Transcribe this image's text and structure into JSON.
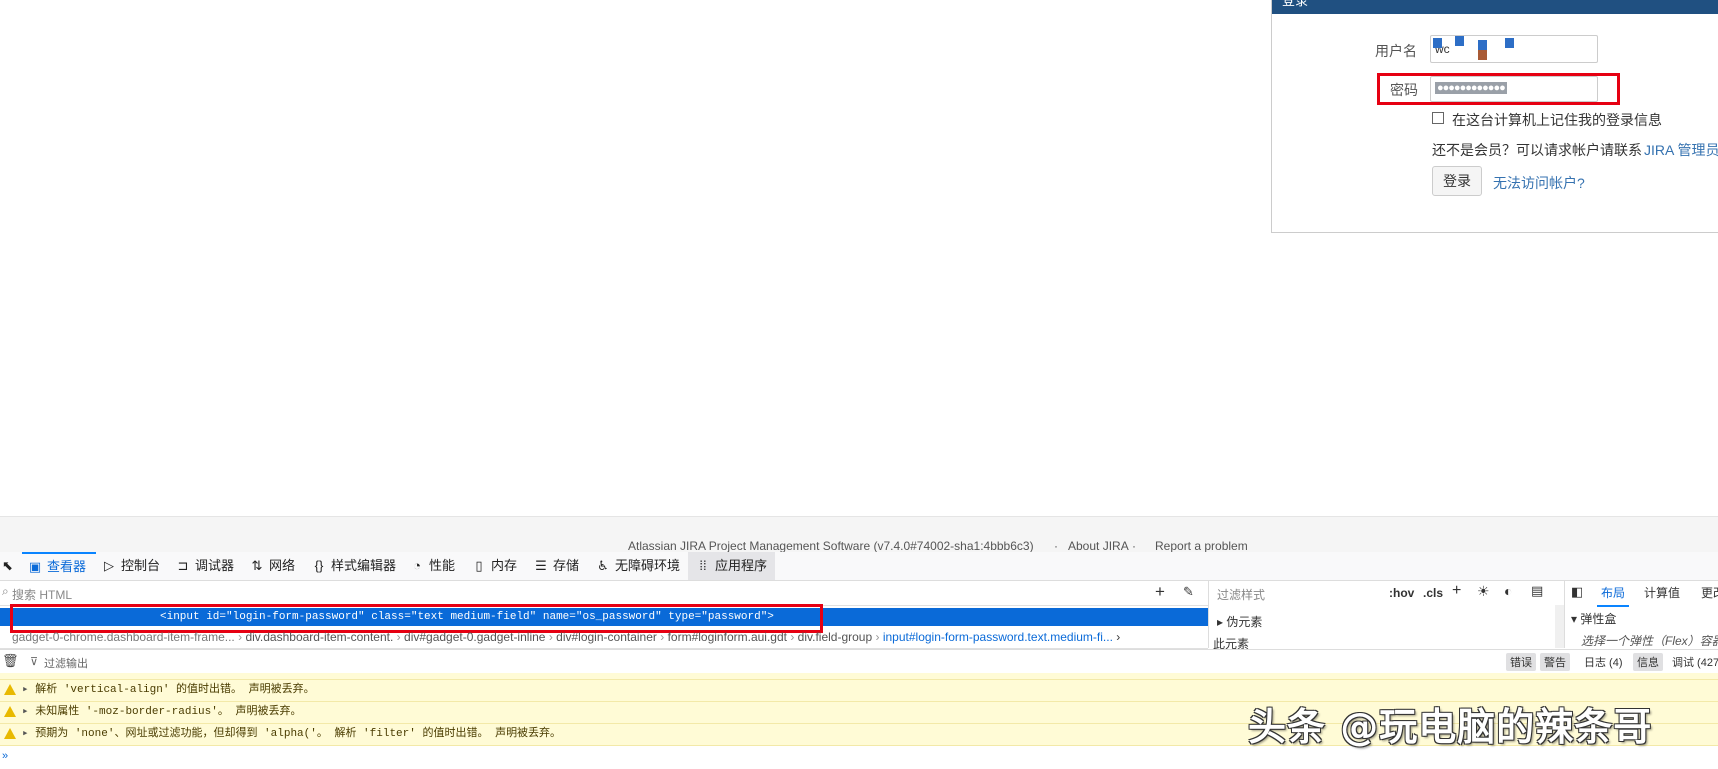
{
  "login": {
    "header": "登录",
    "username_label": "用户名",
    "username_value": "wc",
    "password_label": "密码",
    "password_value": "●●●●●●●●●●●●",
    "remember_label": "在这台计算机上记住我的登录信息",
    "not_member": "还不是会员？可以请求帐户请联系",
    "jira_admin_link": "JIRA 管理员",
    "login_button": "登录",
    "cant_access_link": "无法访问帐户?"
  },
  "footer": {
    "product": "Atlassian JIRA Project Management Software (v7.4.0#74002-sha1:4bbb6c3)",
    "sep": "·",
    "about": "About JIRA",
    "report": "Report a problem"
  },
  "devtools": {
    "tabs": [
      {
        "label": "查看器",
        "icon": "inspector-icon"
      },
      {
        "label": "控制台",
        "icon": "console-icon"
      },
      {
        "label": "调试器",
        "icon": "debugger-icon"
      },
      {
        "label": "网络",
        "icon": "network-icon"
      },
      {
        "label": "样式编辑器",
        "icon": "style-editor-icon"
      },
      {
        "label": "性能",
        "icon": "performance-icon"
      },
      {
        "label": "内存",
        "icon": "memory-icon"
      },
      {
        "label": "存储",
        "icon": "storage-icon"
      },
      {
        "label": "无障碍环境",
        "icon": "accessibility-icon"
      },
      {
        "label": "应用程序",
        "icon": "application-icon"
      }
    ],
    "search_html_placeholder": "搜索 HTML",
    "selected_node": "<input id=\"login-form-password\" class=\"text medium-field\" name=\"os_password\" type=\"password\">",
    "breadcrumb": [
      "gadget-0-chrome.dashboard-item-frame...",
      "div.dashboard-item-content.",
      "div#gadget-0.gadget-inline",
      "div#login-container",
      "form#loginform.aui.gdt",
      "div.field-group",
      "input#login-form-password.text.medium-fi..."
    ],
    "rules": {
      "filter_placeholder": "过滤样式",
      "hov": ":hov",
      "cls": ".cls",
      "pseudo": "伪元素",
      "this_element": "此元素"
    },
    "layout": {
      "tabs": [
        "布局",
        "计算值",
        "更改"
      ],
      "flexbox": "弹性盒",
      "flex_hint": "选择一个弹性（Flex）容器"
    },
    "console": {
      "filter_placeholder": "过滤输出",
      "buttons": [
        "错误",
        "警告",
        "日志 (4)",
        "信息",
        "调试 (427"
      ],
      "messages": [
        "解析 'vertical-align' 的值时出错。  声明被丢弃。",
        "未知属性 '-moz-border-radius'。  声明被丢弃。",
        "预期为 'none'、网址或过滤功能，但却得到 'alpha('。  解析 'filter' 的值时出错。  声明被丢弃。"
      ]
    }
  },
  "watermark": "头条 @玩电脑的辣条哥"
}
